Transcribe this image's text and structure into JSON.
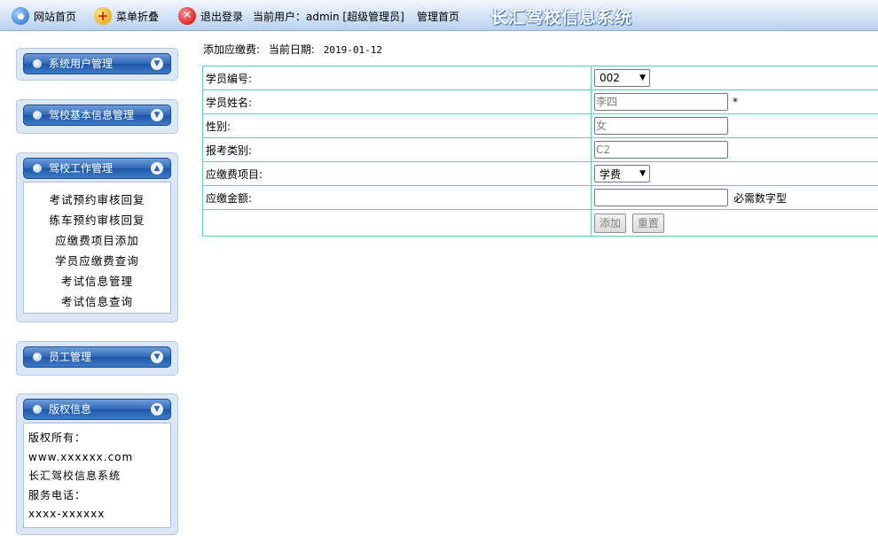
{
  "topbar": {
    "home_label": "网站首页",
    "fold_label": "菜单折叠",
    "logout_label": "退出登录",
    "current_user": "当前用户：admin [超级管理员]",
    "manage_home": "管理首页",
    "system_title": "长汇驾校信息系统"
  },
  "sidebar": {
    "panels": [
      {
        "title": "系统用户管理"
      },
      {
        "title": "驾校基本信息管理"
      },
      {
        "title": "驾校工作管理",
        "links": [
          "考试预约审核回复",
          "练车预约审核回复",
          "应缴费项目添加",
          "学员应缴费查询",
          "考试信息管理",
          "考试信息查询"
        ]
      },
      {
        "title": "员工管理"
      },
      {
        "title": "版权信息",
        "lines": [
          "版权所有：",
          "www.xxxxxx.com",
          "长汇驾校信息系统",
          "服务电话：",
          "xxxx-xxxxxx"
        ]
      }
    ]
  },
  "page": {
    "heading": "添加应缴费:",
    "date_label": "当前日期:",
    "date_value": "2019-01-12"
  },
  "form": {
    "student_id_label": "学员编号:",
    "student_id_value": "002",
    "student_name_label": "学员姓名:",
    "student_name_value": "李四",
    "required_mark": "*",
    "gender_label": "性别:",
    "gender_value": "女",
    "license_label": "报考类别:",
    "license_value": "C2",
    "fee_item_label": "应缴费项目:",
    "fee_item_value": "学费",
    "amount_label": "应缴金额:",
    "amount_value": "",
    "amount_hint": "必需数字型",
    "add_button": "添加",
    "reset_button": "重置"
  }
}
